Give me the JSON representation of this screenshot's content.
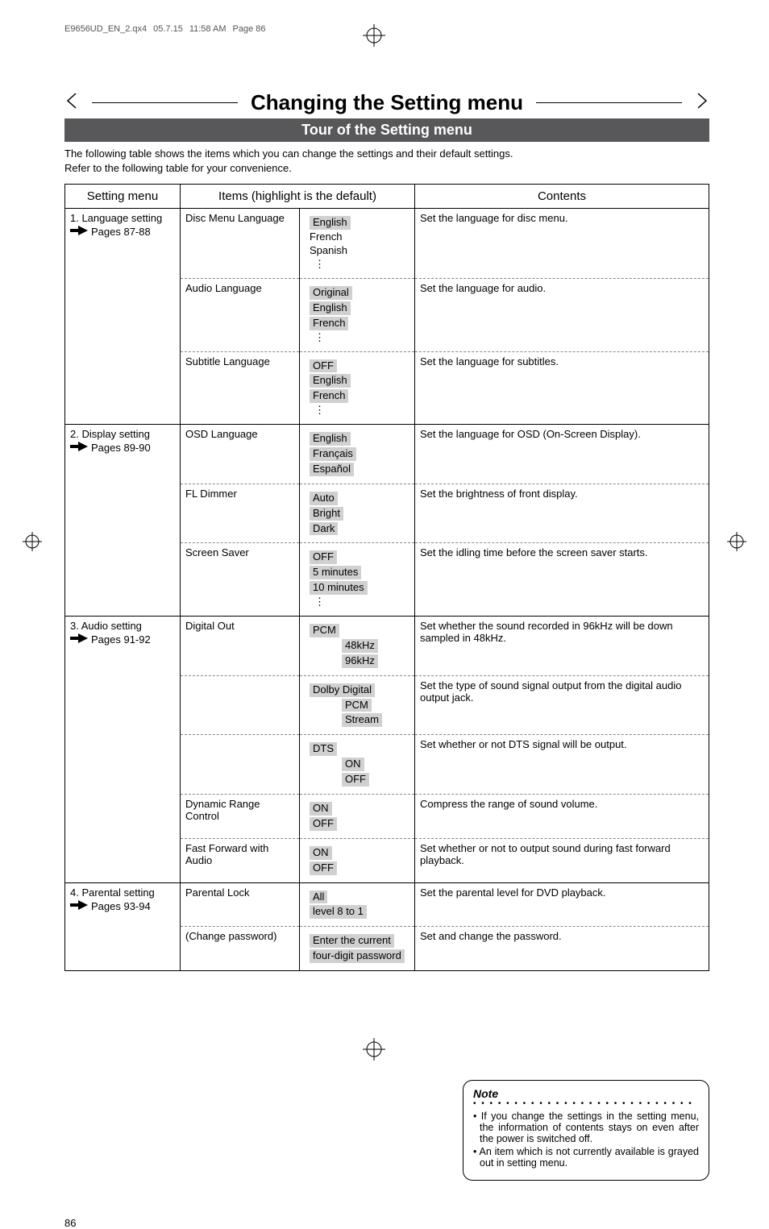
{
  "header": {
    "filename": "E9656UD_EN_2.qx4",
    "date": "05.7.15",
    "time": "11:58 AM",
    "page_label": "Page 86"
  },
  "title": "Changing the Setting menu",
  "subtitle": "Tour of the Setting menu",
  "intro_line1": "The following table shows the items which you can change the settings and their default settings.",
  "intro_line2": "Refer to the following table for your convenience.",
  "table": {
    "headers": {
      "menu": "Setting menu",
      "items": "Items (highlight is the default)",
      "contents": "Contents"
    },
    "sections": [
      {
        "menu_title": "1. Language setting",
        "pages": "Pages 87-88",
        "rows": [
          {
            "item": "Disc Menu Language",
            "values": [
              {
                "text": "English",
                "hl": true
              },
              {
                "text": "French"
              },
              {
                "text": "Spanish"
              }
            ],
            "vdots": true,
            "content": "Set the language for disc menu."
          },
          {
            "item": "Audio Language",
            "values": [
              {
                "text": "Original",
                "hl": true
              },
              {
                "text": "English",
                "hl": true
              },
              {
                "text": "French",
                "hl": true
              }
            ],
            "vdots": true,
            "content": "Set the language for audio."
          },
          {
            "item": "Subtitle Language",
            "values": [
              {
                "text": "OFF",
                "hl": true
              },
              {
                "text": "English",
                "hl": true
              },
              {
                "text": "French",
                "hl": true
              }
            ],
            "vdots": true,
            "content": "Set the language for subtitles."
          }
        ]
      },
      {
        "menu_title": "2. Display setting",
        "pages": "Pages 89-90",
        "rows": [
          {
            "item": "OSD Language",
            "values": [
              {
                "text": "English",
                "hl": true
              },
              {
                "text": "Français",
                "hl": true
              },
              {
                "text": "Español",
                "hl": true
              }
            ],
            "content": "Set the language for OSD (On-Screen Display)."
          },
          {
            "item": "FL Dimmer",
            "values": [
              {
                "text": "Auto",
                "hl": true
              },
              {
                "text": "Bright",
                "hl": true
              },
              {
                "text": "Dark",
                "hl": true
              }
            ],
            "content": "Set the brightness of front display."
          },
          {
            "item": "Screen Saver",
            "values": [
              {
                "text": "OFF",
                "hl": true
              },
              {
                "text": "5 minutes",
                "hl": true
              },
              {
                "text": "10 minutes",
                "hl": true
              }
            ],
            "vdots": true,
            "content": "Set the idling time before the screen saver starts."
          }
        ]
      },
      {
        "menu_title": "3. Audio setting",
        "pages": "Pages 91-92",
        "rows": [
          {
            "item": "Digital Out",
            "values": [
              {
                "text": "PCM",
                "hl": true
              },
              {
                "text": "48kHz",
                "hl": true,
                "indent": true
              },
              {
                "text": "96kHz",
                "hl": true,
                "indent": true
              }
            ],
            "content": "Set whether the sound recorded in 96kHz will be down sampled in 48kHz."
          },
          {
            "item": "",
            "values": [
              {
                "text": "Dolby Digital",
                "hl": true
              },
              {
                "text": "PCM",
                "hl": true,
                "indent": true
              },
              {
                "text": "Stream",
                "hl": true,
                "indent": true
              }
            ],
            "content": "Set the type of sound signal output from the digital audio output jack."
          },
          {
            "item": "",
            "values": [
              {
                "text": "DTS",
                "hl": true
              },
              {
                "text": "ON",
                "hl": true,
                "indent": true
              },
              {
                "text": "OFF",
                "hl": true,
                "indent": true
              }
            ],
            "content": "Set whether or not DTS signal will be output."
          },
          {
            "item": "Dynamic Range Control",
            "values": [
              {
                "text": "ON",
                "hl": true
              },
              {
                "text": "OFF",
                "hl": true
              }
            ],
            "content": "Compress the range of sound volume."
          },
          {
            "item": "Fast Forward with Audio",
            "values": [
              {
                "text": "ON",
                "hl": true
              },
              {
                "text": "OFF",
                "hl": true
              }
            ],
            "content": "Set whether or not to output sound during fast forward playback."
          }
        ]
      },
      {
        "menu_title": "4. Parental setting",
        "pages": "Pages 93-94",
        "rows": [
          {
            "item": "Parental Lock",
            "values": [
              {
                "text": "All",
                "hl": true
              },
              {
                "text": "level 8 to 1",
                "hl": true
              }
            ],
            "content": "Set the parental level for DVD playback."
          },
          {
            "item": "(Change password)",
            "values": [
              {
                "text": "Enter the current",
                "hl": true
              },
              {
                "text": "four-digit password",
                "hl": true
              }
            ],
            "content": "Set and change the password."
          }
        ]
      }
    ]
  },
  "note": {
    "title": "Note",
    "items": [
      "• If you change the settings in the setting menu, the information of contents stays on even after the power is switched off.",
      "• An item which is not currently available is grayed out in setting menu."
    ]
  },
  "page_number": "86"
}
